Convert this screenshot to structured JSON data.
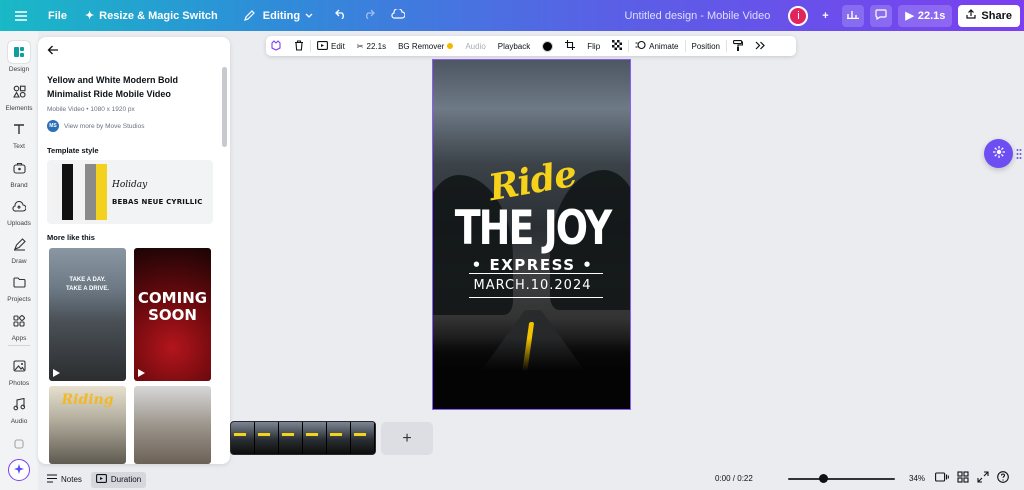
{
  "topbar": {
    "file_label": "File",
    "resize_label": "Resize & Magic Switch",
    "editing_label": "Editing",
    "doc_title": "Untitled design - Mobile Video",
    "avatar_initial": "i",
    "play_duration": "22.1s",
    "share_label": "Share"
  },
  "rail": {
    "items": [
      {
        "label": "Design",
        "icon": "design-icon"
      },
      {
        "label": "Elements",
        "icon": "elements-icon"
      },
      {
        "label": "Text",
        "icon": "text-icon"
      },
      {
        "label": "Brand",
        "icon": "brand-icon"
      },
      {
        "label": "Uploads",
        "icon": "uploads-icon"
      },
      {
        "label": "Draw",
        "icon": "draw-icon"
      },
      {
        "label": "Projects",
        "icon": "projects-icon"
      },
      {
        "label": "Apps",
        "icon": "apps-icon"
      },
      {
        "label": "Photos",
        "icon": "photos-icon"
      },
      {
        "label": "Audio",
        "icon": "audio-icon"
      }
    ]
  },
  "panel": {
    "title": "Yellow and White Modern Bold Minimalist Ride Mobile Video",
    "meta": "Mobile Video • 1080 x 1920 px",
    "author_badge": "MS",
    "author": "View more by Move Studios",
    "template_style_label": "Template style",
    "swatch_colors": [
      "#f2f2f2",
      "#111111",
      "#f2f2f2",
      "#8a8a8a",
      "#f2d21f"
    ],
    "font_sample_1": "Holiday",
    "font_sample_2": "BEBAS NEUE CYRILLIC",
    "more_like_label": "More like this",
    "thumbs": [
      {
        "text": "TAKE A DAY.\nTAKE A DRIVE."
      },
      {
        "text": "COMING SOON"
      },
      {
        "text": "Riding"
      },
      {
        "text": ""
      }
    ]
  },
  "context_toolbar": {
    "edit": "Edit",
    "duration": "22.1s",
    "bg_remover": "BG Remover",
    "audio": "Audio",
    "playback": "Playback",
    "flip": "Flip",
    "animate": "Animate",
    "position": "Position"
  },
  "design": {
    "ride": "Ride",
    "the_joy": "THE JOY",
    "express": "• EXPRESS •",
    "date": "MARCH.10.2024",
    "colors": {
      "accent": "#f6d31a",
      "text": "#ffffff"
    }
  },
  "timeline": {
    "add_label": "+"
  },
  "bottombar": {
    "notes_label": "Notes",
    "duration_label": "Duration",
    "time": "0:00 / 0:22",
    "playhead_fraction": 0.0,
    "zoom": "34%"
  }
}
